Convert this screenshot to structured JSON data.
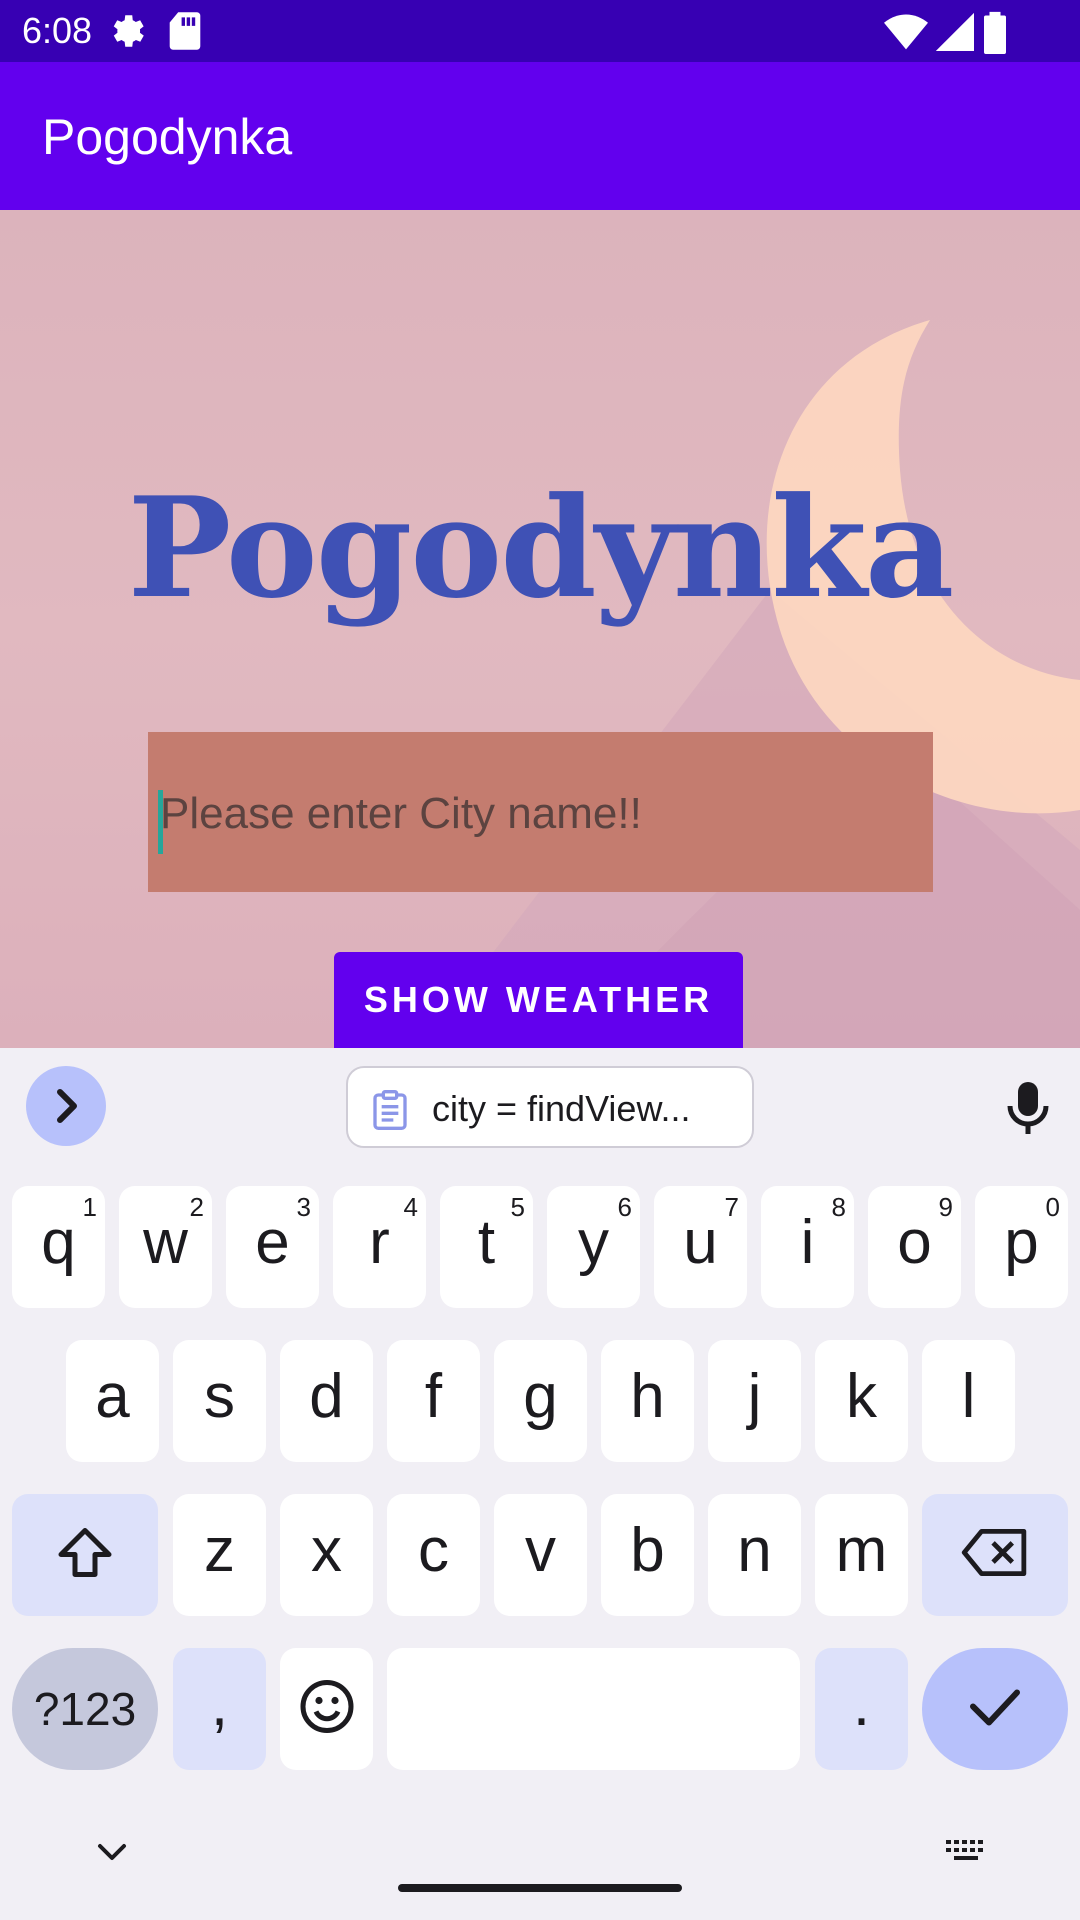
{
  "status_bar": {
    "time": "6:08"
  },
  "app_bar": {
    "title": "Pogodynka"
  },
  "main": {
    "hero_title": "Pogodynka",
    "city_input": {
      "placeholder": "Please enter City name!!",
      "value": ""
    },
    "show_button_label": "SHOW WEATHER"
  },
  "keyboard": {
    "clipboard_suggestion": "city = findView...",
    "row1": [
      {
        "key": "q",
        "hint": "1"
      },
      {
        "key": "w",
        "hint": "2"
      },
      {
        "key": "e",
        "hint": "3"
      },
      {
        "key": "r",
        "hint": "4"
      },
      {
        "key": "t",
        "hint": "5"
      },
      {
        "key": "y",
        "hint": "6"
      },
      {
        "key": "u",
        "hint": "7"
      },
      {
        "key": "i",
        "hint": "8"
      },
      {
        "key": "o",
        "hint": "9"
      },
      {
        "key": "p",
        "hint": "0"
      }
    ],
    "row2": [
      "a",
      "s",
      "d",
      "f",
      "g",
      "h",
      "j",
      "k",
      "l"
    ],
    "row3": [
      "z",
      "x",
      "c",
      "v",
      "b",
      "n",
      "m"
    ],
    "symbols_label": "?123",
    "comma_label": ",",
    "period_label": "."
  },
  "colors": {
    "status_bar": "#3700b3",
    "app_bar": "#6200ee",
    "hero_title": "#3f51b5",
    "input_bg": "#c47c6f",
    "button": "#6200ee"
  },
  "icons": [
    "gear-icon",
    "sd-card-icon",
    "wifi-icon",
    "signal-icon",
    "battery-icon",
    "chevron-right-icon",
    "clipboard-icon",
    "mic-icon",
    "shift-icon",
    "backspace-icon",
    "emoji-icon",
    "check-icon",
    "chevron-down-icon",
    "keyboard-icon"
  ]
}
